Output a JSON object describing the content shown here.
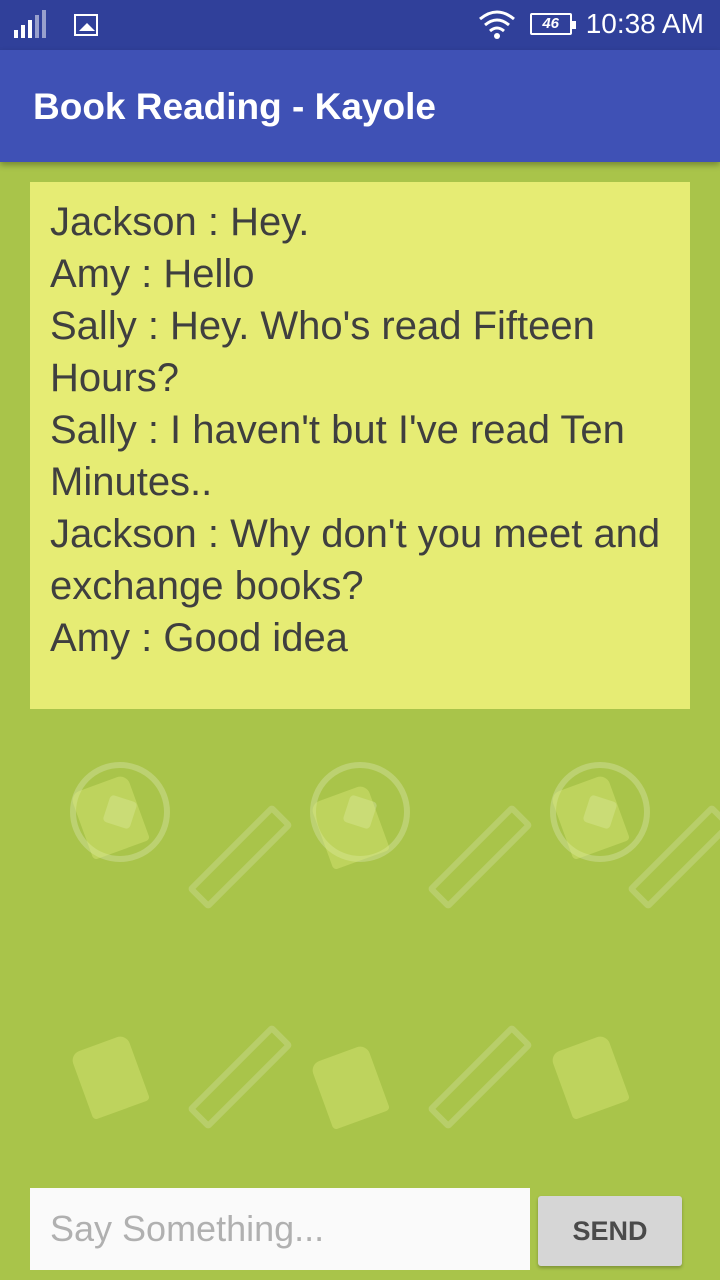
{
  "status_bar": {
    "battery_level": "46",
    "time": "10:38 AM",
    "icons": [
      "signal-icon",
      "gallery-icon",
      "wifi-icon",
      "battery-icon"
    ]
  },
  "app_bar": {
    "title": "Book Reading - Kayole"
  },
  "chat": {
    "messages": [
      "Jackson : Hey.",
      "Amy : Hello",
      "Sally : Hey. Who's read Fifteen Hours?",
      "Sally : I haven't but I've read Ten Minutes..",
      "Jackson : Why don't you meet and exchange books?",
      "Amy : Good idea"
    ]
  },
  "composer": {
    "placeholder": "Say Something...",
    "value": "",
    "send_label": "SEND"
  },
  "colors": {
    "status_bar": "#30409a",
    "app_bar": "#3f51b5",
    "background": "#a9c44a",
    "chat_box": "#e6ec74"
  }
}
